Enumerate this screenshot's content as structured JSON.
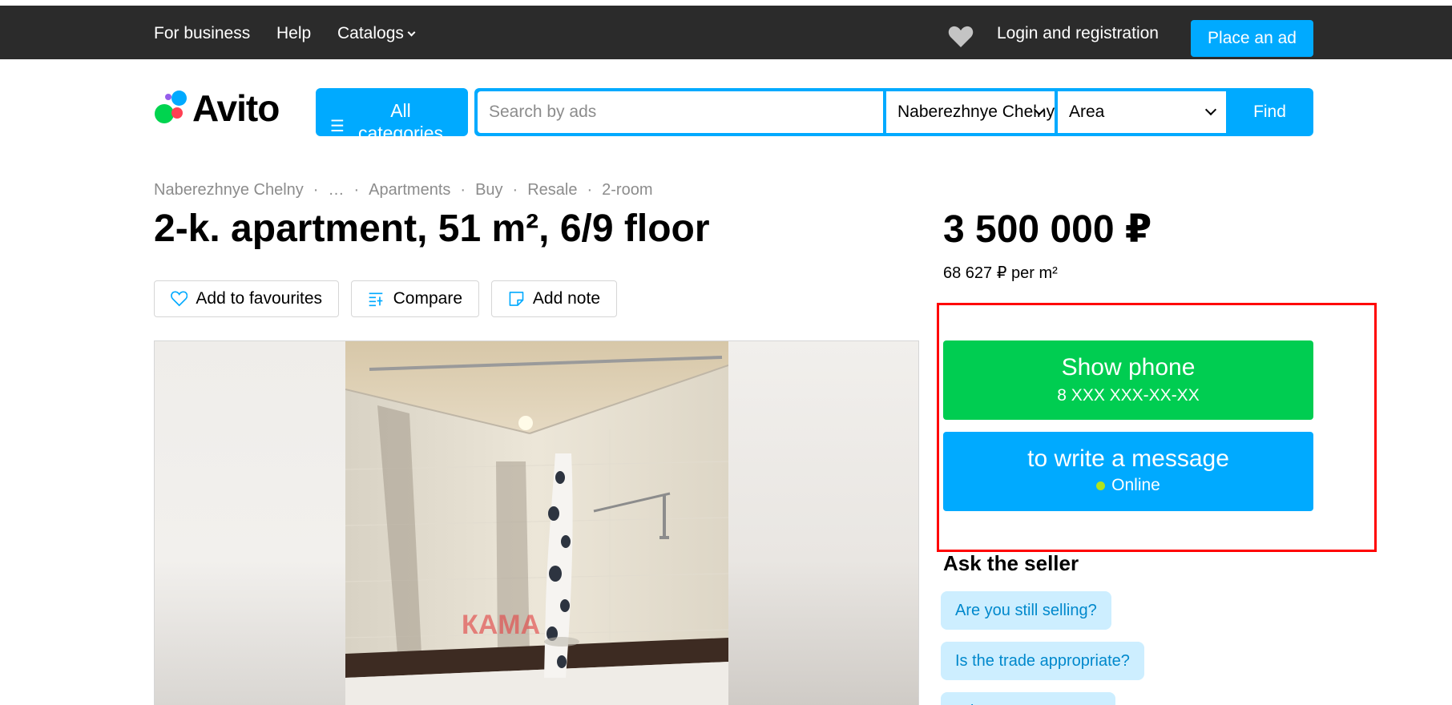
{
  "topbar": {
    "for_business": "For business",
    "help": "Help",
    "catalogs": "Catalogs",
    "login": "Login and registration",
    "place_ad": "Place an ad"
  },
  "header": {
    "logo_text": "Avito",
    "all_categories": "All categories",
    "search_placeholder": "Search by ads",
    "city": "Naberezhnye Chelny",
    "area": "Area",
    "find": "Find"
  },
  "breadcrumbs": [
    "Naberezhnye Chelny",
    "…",
    "Apartments",
    "Buy",
    "Resale",
    "2-room"
  ],
  "listing": {
    "title": "2-k. apartment, 51 m², 6/9 floor",
    "price": "3 500 000 ₽",
    "price_per_m2": "68 627 ₽ per m²"
  },
  "actions": {
    "favourites": "Add to favourites",
    "compare": "Compare",
    "note": "Add note"
  },
  "contact": {
    "show_phone": "Show phone",
    "phone_mask": "8 XXX XXX-XX-XX",
    "write_message": "to write a message",
    "status": "Online"
  },
  "ask_seller": {
    "title": "Ask the seller",
    "questions": [
      "Are you still selling?",
      "Is the trade appropriate?",
      "When can we meet?"
    ]
  },
  "photo": {
    "watermark": "КАМА"
  },
  "colors": {
    "topbar_bg": "#2b2b2b",
    "accent_blue": "#00aaff",
    "phone_green": "#00cd51",
    "online_dot": "#b1e31b",
    "chip_bg": "#cdeeff",
    "highlight_red": "#ff0000"
  }
}
